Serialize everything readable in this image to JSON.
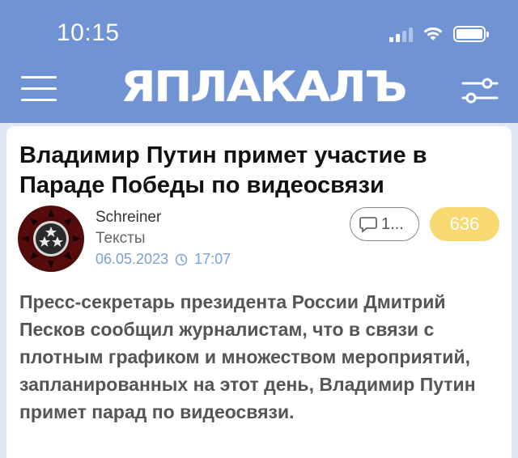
{
  "status_bar": {
    "time": "10:15"
  },
  "header": {
    "logo_text": "ЯПЛАКАЛЪ",
    "menu_icon": "hamburger-icon",
    "filter_icon": "settings-sliders-icon"
  },
  "post": {
    "title": "Владимир Путин примет участие в Параде Победы по видеосвязи",
    "author": "Schreiner",
    "category": "Тексты",
    "date": "06.05.2023",
    "time": "17:07",
    "comments_label": "1...",
    "rating": "636",
    "body": "Пресс-секретарь президента России Дмитрий Песков сообщил журналистам, что в связи с плотным графиком и множеством мероприятий, запланированных на этот день, Владимир Путин примет парад по видеосвязи."
  },
  "colors": {
    "header_bg": "#6f93d3",
    "rating_bg": "#f8d870",
    "meta_text": "#7aa0d8"
  }
}
